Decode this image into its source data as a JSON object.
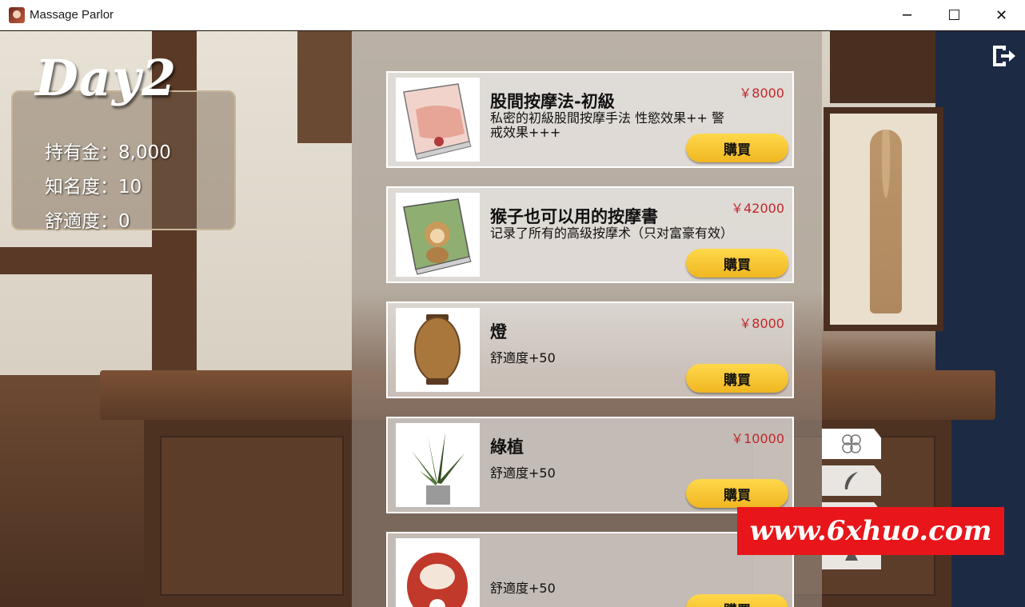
{
  "window": {
    "title": "Massage Parlor",
    "minimize_glyph": "─",
    "maximize_glyph": "☐",
    "close_glyph": "✕"
  },
  "status": {
    "day": "Day2",
    "money": "持有金：8,000",
    "fame": "知名度：10",
    "comfort": "舒適度：0"
  },
  "shop": {
    "items": [
      {
        "name": "股間按摩法-初級",
        "desc": "私密的初級股間按摩手法 性慾效果++ 警戒效果+++",
        "price": "￥8000",
        "buy": "購買",
        "image": "pink-book-image"
      },
      {
        "name": "猴子也可以用的按摩書",
        "desc": "记录了所有的高级按摩术（只对富豪有效）",
        "price": "￥42000",
        "buy": "購買",
        "image": "green-book-image"
      },
      {
        "name": "燈",
        "desc": "舒適度+50",
        "price": "￥8000",
        "buy": "購買",
        "image": "lantern-image"
      },
      {
        "name": "綠植",
        "desc": "舒適度+50",
        "price": "￥10000",
        "buy": "購買",
        "image": "potted-plant-image"
      },
      {
        "name": "",
        "desc": "舒適度+50",
        "price": "",
        "buy": "購買",
        "image": "daruma-image"
      }
    ]
  },
  "side_tabs": [
    "flower-icon",
    "feather-icon",
    "leaf-icon",
    "misc-icon"
  ],
  "watermark": "www.6xhuo.com",
  "colors": {
    "price": "#c0282d",
    "button": "#f5c431",
    "watermark": "#e8161a"
  }
}
